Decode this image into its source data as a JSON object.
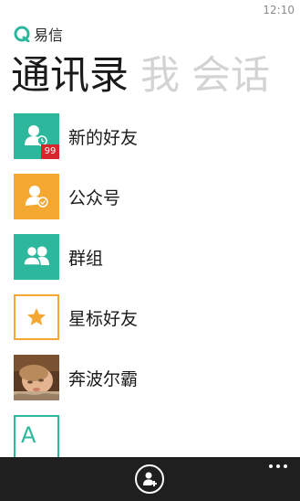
{
  "status_bar": {
    "time": "12:10"
  },
  "app": {
    "name": "易信",
    "brand_color": "#2db79c"
  },
  "pivot": {
    "items": [
      {
        "label": "通讯录",
        "active": true
      },
      {
        "label": "我",
        "active": false
      },
      {
        "label": "会话",
        "active": false
      }
    ]
  },
  "contacts": {
    "items": [
      {
        "label": "新的好友",
        "icon": "new-friend-icon",
        "color": "#2db79c",
        "badge": "99"
      },
      {
        "label": "公众号",
        "icon": "public-account-icon",
        "color": "#f4a831"
      },
      {
        "label": "群组",
        "icon": "group-icon",
        "color": "#2db79c"
      },
      {
        "label": "星标好友",
        "icon": "star-icon",
        "color": "#f4a831"
      },
      {
        "label": "奔波尔霸",
        "icon": "contact-photo"
      }
    ],
    "index_letter": "A"
  },
  "app_bar": {
    "background": "#1f1f1f",
    "add_contact_icon": "add-contact-icon",
    "more_icon": "more-icon"
  }
}
